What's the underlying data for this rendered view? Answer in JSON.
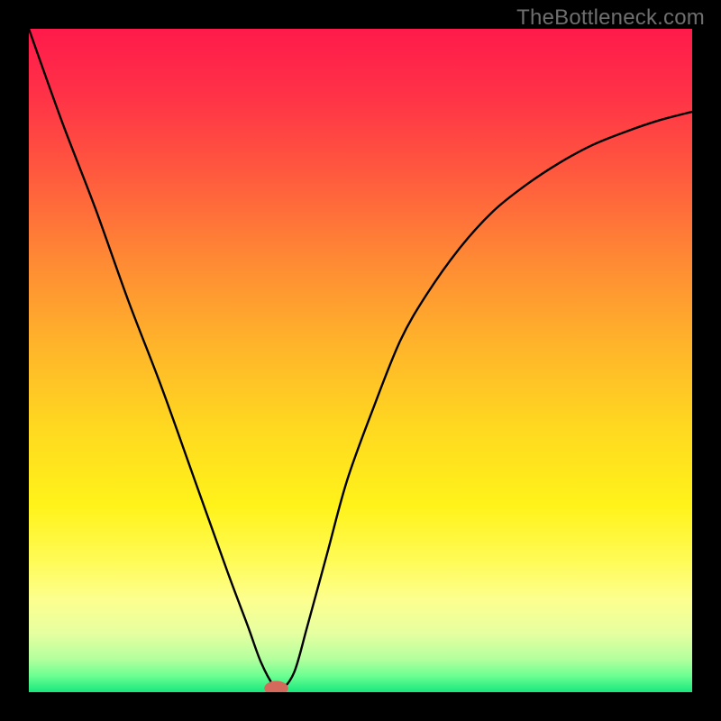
{
  "watermark": "TheBottleneck.com",
  "chart_data": {
    "type": "line",
    "title": "",
    "xlabel": "",
    "ylabel": "",
    "xlim": [
      0,
      100
    ],
    "ylim": [
      0,
      100
    ],
    "series": [
      {
        "name": "curve",
        "x": [
          0,
          5,
          10,
          15,
          20,
          25,
          30,
          33,
          35,
          37,
          38,
          40,
          42,
          45,
          48,
          52,
          56,
          60,
          65,
          70,
          75,
          80,
          85,
          90,
          95,
          100
        ],
        "y": [
          100,
          86,
          73,
          59,
          46,
          32,
          18,
          10,
          4.5,
          0.8,
          0.3,
          3,
          10,
          21,
          32,
          43,
          53,
          60,
          67,
          72.5,
          76.5,
          79.8,
          82.5,
          84.5,
          86.2,
          87.5
        ]
      }
    ],
    "marker": {
      "x": 37.3,
      "y": 0.6,
      "color": "#d46a5b",
      "rx": 1.8,
      "ry": 1.1
    },
    "gradient_stops": [
      {
        "offset": 0.0,
        "color": "#ff1a4b"
      },
      {
        "offset": 0.1,
        "color": "#ff3247"
      },
      {
        "offset": 0.22,
        "color": "#ff5a3e"
      },
      {
        "offset": 0.35,
        "color": "#ff8a34"
      },
      {
        "offset": 0.48,
        "color": "#ffb52a"
      },
      {
        "offset": 0.6,
        "color": "#ffd820"
      },
      {
        "offset": 0.72,
        "color": "#fff31a"
      },
      {
        "offset": 0.8,
        "color": "#fffb55"
      },
      {
        "offset": 0.86,
        "color": "#fdff8e"
      },
      {
        "offset": 0.91,
        "color": "#e7ffa0"
      },
      {
        "offset": 0.95,
        "color": "#b4ff9e"
      },
      {
        "offset": 0.975,
        "color": "#6dff91"
      },
      {
        "offset": 1.0,
        "color": "#18e87e"
      }
    ]
  }
}
